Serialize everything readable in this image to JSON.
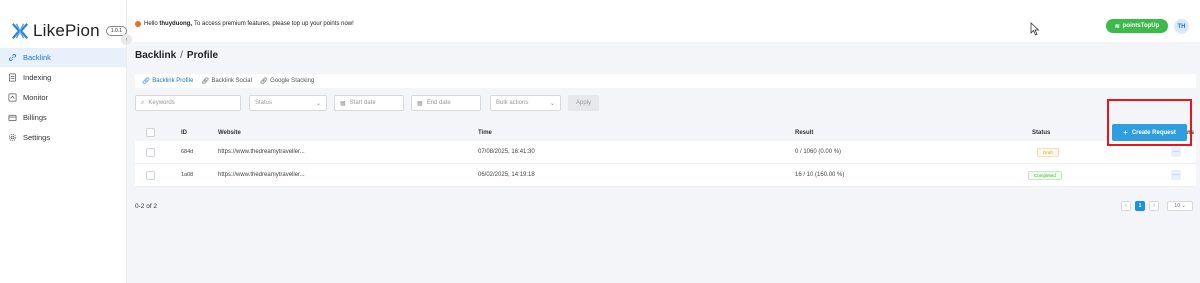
{
  "app": {
    "name": "LikePion",
    "version": "1.0.1"
  },
  "colors": {
    "accent": "#1677d2",
    "primary_button": "#2f9ee0",
    "topup": "#3dbb4a",
    "highlight": "#e8161b"
  },
  "sidebar": {
    "items": [
      {
        "label": "Backlink",
        "icon": "link-icon",
        "active": true
      },
      {
        "label": "Indexing",
        "icon": "document-icon",
        "active": false
      },
      {
        "label": "Monitor",
        "icon": "monitor-icon",
        "active": false
      },
      {
        "label": "Billings",
        "icon": "wallet-icon",
        "active": false
      },
      {
        "label": "Settings",
        "icon": "gear-icon",
        "active": false
      }
    ]
  },
  "topbar": {
    "greeting_prefix": "Hello",
    "username": "thuyduong,",
    "message": "To access premium features, please top up your points now!",
    "topup_label": "pointsTopUp",
    "avatar_initials": "TH"
  },
  "breadcrumb": {
    "root": "Backlink",
    "separator": "/",
    "current": "Profile"
  },
  "tabs": [
    {
      "label": "Backlink Profile",
      "active": true
    },
    {
      "label": "Backlink Social",
      "active": false
    },
    {
      "label": "Google Stacking",
      "active": false
    }
  ],
  "filters": {
    "keywords_placeholder": "Keywords",
    "status_placeholder": "Status",
    "start_date_placeholder": "Start date",
    "end_date_placeholder": "End date",
    "bulk_actions_placeholder": "Bulk actions",
    "apply_label": "Apply"
  },
  "create_button_label": "Create Request",
  "table": {
    "columns": {
      "id": "ID",
      "website": "Website",
      "time": "Time",
      "result": "Result",
      "status": "Status",
      "actions": "Actions"
    },
    "rows": [
      {
        "id": "684d",
        "website": "https://www.thedreamytraveller...",
        "time": "07/08/2025, 16:41:30",
        "result": "0 / 1060 (0.00 %)",
        "status": "Draft",
        "action": "···"
      },
      {
        "id": "1a08",
        "website": "https://www.thedreamytraveller...",
        "time": "06/02/2025, 14:19:18",
        "result": "16 / 10 (160.00 %)",
        "status": "Completed",
        "action": "···"
      }
    ]
  },
  "pagination": {
    "summary": "0-2 of 2",
    "prev": "<",
    "current_page": "1",
    "next": ">",
    "page_size": "10"
  }
}
